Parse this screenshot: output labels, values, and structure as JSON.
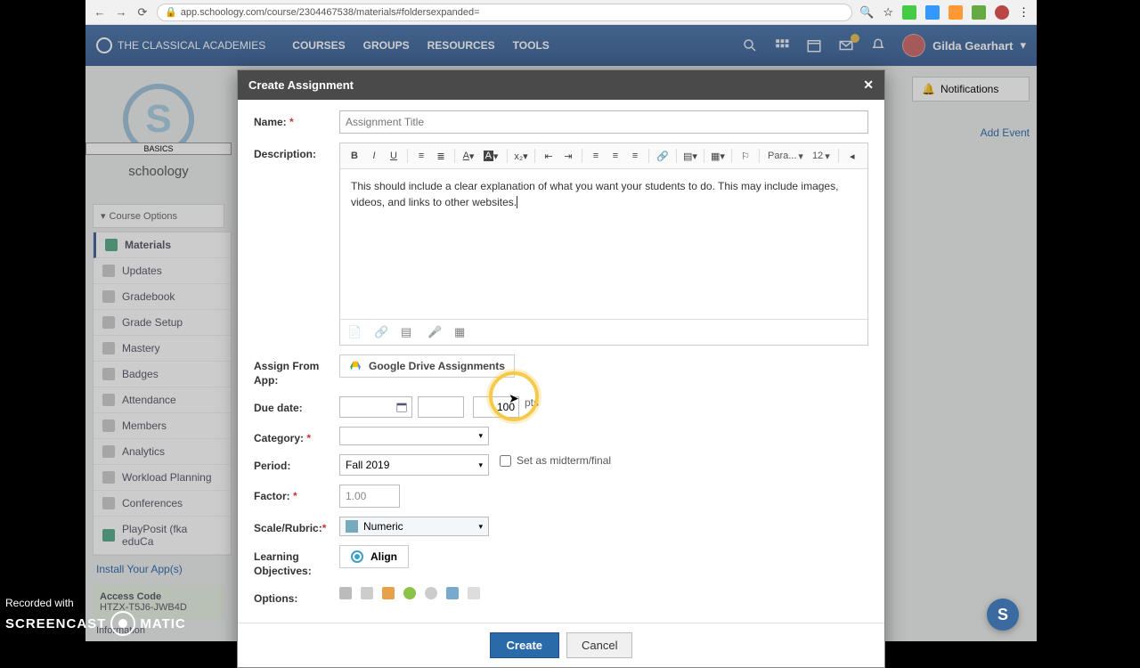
{
  "browser": {
    "url": "app.schoology.com/course/2304467538/materials#foldersexpanded="
  },
  "topbar": {
    "brand": "THE CLASSICAL ACADEMIES",
    "nav": [
      "COURSES",
      "GROUPS",
      "RESOURCES",
      "TOOLS"
    ],
    "user_name": "Gilda Gearhart"
  },
  "sidebar": {
    "basics_label": "BASICS",
    "schoology_label": "schoology",
    "course_options": "Course Options",
    "menu": [
      {
        "label": "Materials",
        "active": true
      },
      {
        "label": "Updates"
      },
      {
        "label": "Gradebook"
      },
      {
        "label": "Grade Setup"
      },
      {
        "label": "Mastery"
      },
      {
        "label": "Badges"
      },
      {
        "label": "Attendance"
      },
      {
        "label": "Members"
      },
      {
        "label": "Analytics"
      },
      {
        "label": "Workload Planning"
      },
      {
        "label": "Conferences"
      },
      {
        "label": "PlayPosit (fka eduCa"
      }
    ],
    "install_link": "Install Your App(s)",
    "access_code_label": "Access Code",
    "access_code": "HTZX-T5J6-JWB4D",
    "information_label": "Information"
  },
  "right_col": {
    "notifications": "Notifications",
    "add_event": "Add Event"
  },
  "modal": {
    "title": "Create Assignment",
    "labels": {
      "name": "Name:",
      "description": "Description:",
      "assign_from_app": "Assign From App:",
      "due_date": "Due date:",
      "category": "Category:",
      "period": "Period:",
      "factor": "Factor:",
      "scale_rubric": "Scale/Rubric:",
      "learning_objectives": "Learning Objectives:",
      "options": "Options:"
    },
    "name_placeholder": "Assignment Title",
    "description_text": "This should include a clear explanation of what you want your students to do. This may include images, videos, and links to other websites. ",
    "toolbar": {
      "para": "Para...",
      "font_size": "12"
    },
    "gdrive_label": "Google Drive Assignments",
    "points_value": "100",
    "points_label": "pts",
    "period_value": "Fall 2019",
    "midterm_label": "Set as midterm/final",
    "factor_value": "1.00",
    "scale_value": "Numeric",
    "align_label": "Align",
    "create_btn": "Create",
    "cancel_btn": "Cancel"
  },
  "watermark": {
    "recorded": "Recorded with",
    "brand": "SCREENCAST",
    "brand2": "MATIC"
  }
}
